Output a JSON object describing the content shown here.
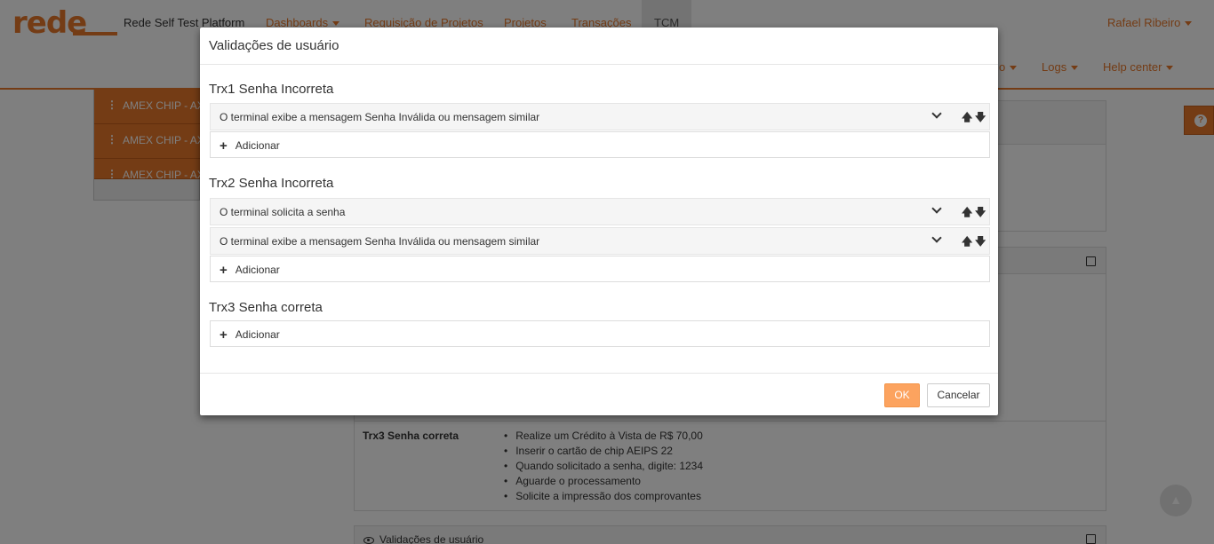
{
  "header": {
    "logo": "rede",
    "brand": "Rede Self Test Platform",
    "nav": [
      "Dashboards",
      "Requisição de Projetos",
      "Projetos",
      "Transações",
      "TCM"
    ],
    "nav_second": [
      "o",
      "Logs",
      "Help center"
    ],
    "user": "Rafael Ribeiro"
  },
  "sidebar": {
    "items": [
      "AMEX CHIP - AX",
      "AMEX CHIP - AX",
      "AMEX CHIP - AX"
    ]
  },
  "background": {
    "trx3_label": "Trx3 Senha correta",
    "trx3_steps": [
      "Realize um Crédito à Vista de R$ 70,00",
      "Inserir o cartão de chip AEIPS 22",
      "Quando solicitado a senha, digite: 1234",
      "Aguarde o processamento",
      "Solicite a impressão dos comprovantes"
    ],
    "validations_header": "Validações de usuário"
  },
  "modal": {
    "title": "Validações de usuário",
    "sections": [
      {
        "title": "Trx1 Senha Incorreta",
        "rows": [
          "O terminal exibe a mensagem Senha Inválida ou mensagem similar"
        ],
        "add_label": "Adicionar"
      },
      {
        "title": "Trx2 Senha Incorreta",
        "rows": [
          "O terminal solicita a senha",
          "O terminal exibe a mensagem Senha Inválida ou mensagem similar"
        ],
        "add_label": "Adicionar"
      },
      {
        "title": "Trx3 Senha correta",
        "rows": [],
        "add_label": "Adicionar"
      }
    ],
    "ok_label": "OK",
    "cancel_label": "Cancelar"
  },
  "colors": {
    "accent": "#e8782a",
    "ok_button": "#fca35f"
  },
  "icons": [
    "chevron-down-icon",
    "arrow-up-icon",
    "arrow-down-icon",
    "plus-icon",
    "help-icon",
    "edit-icon",
    "eye-icon",
    "scroll-top-icon"
  ]
}
